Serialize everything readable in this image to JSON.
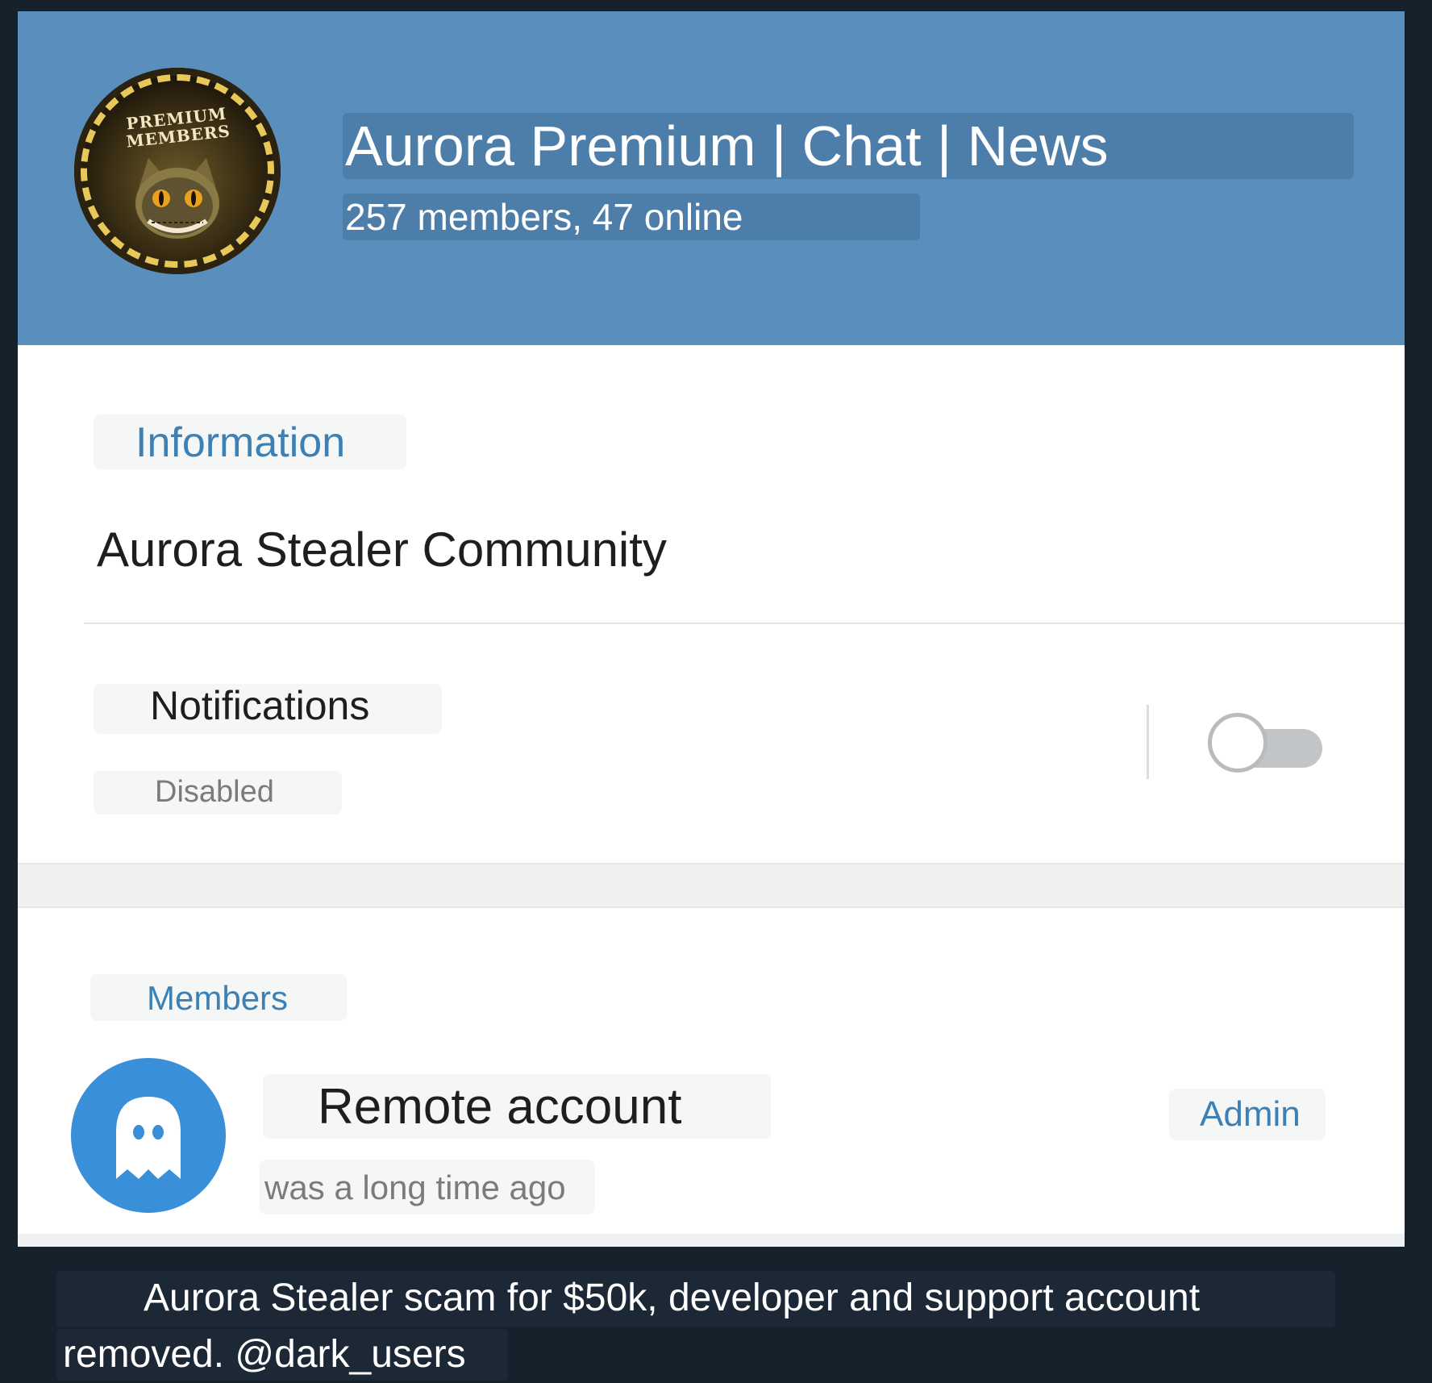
{
  "header": {
    "title": "Aurora Premium | Chat | News",
    "subtitle": "257 members, 47 online",
    "avatar_badge_text": "PREMIUM MEMBERS"
  },
  "information": {
    "label": "Information",
    "description": "Aurora Stealer Community"
  },
  "notifications": {
    "label": "Notifications",
    "status": "Disabled",
    "enabled": false
  },
  "members": {
    "label": "Members",
    "items": [
      {
        "name": "Remote account",
        "status": "was a long time ago",
        "role": "Admin",
        "avatar_icon": "ghost-icon"
      }
    ]
  },
  "caption": {
    "line1": "Aurora Stealer scam for $50k, developer and support account",
    "line2": "removed. @dark_users"
  },
  "colors": {
    "header_bg": "#5a8fbd",
    "accent": "#3d80b4",
    "page_bg": "#17212b",
    "member_avatar_bg": "#3a8fd9"
  }
}
